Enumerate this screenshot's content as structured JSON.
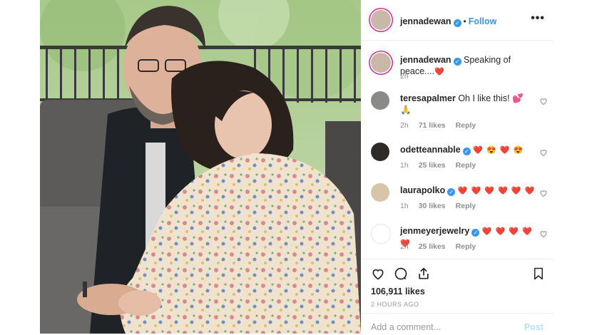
{
  "header": {
    "username": "jennadewan",
    "verified": true,
    "follow_label": "Follow",
    "dot": "•",
    "more": "•••"
  },
  "caption": {
    "username": "jennadewan",
    "text": "Speaking of peace....",
    "emoji": "❤️",
    "time": "2h"
  },
  "comments": [
    {
      "username": "teresapalmer",
      "verified": false,
      "text": "Oh I like this! 💕 🙏",
      "time": "2h",
      "likes": "71 likes",
      "reply": "Reply"
    },
    {
      "username": "odetteannable",
      "verified": true,
      "text": "❤️ 😍 ❤️ 😍",
      "time": "1h",
      "likes": "25 likes",
      "reply": "Reply"
    },
    {
      "username": "laurapolko",
      "verified": true,
      "text": "❤️ ❤️ ❤️ ❤️ ❤️ ❤️",
      "time": "1h",
      "likes": "30 likes",
      "reply": "Reply"
    },
    {
      "username": "jenmeyerjewelry",
      "verified": true,
      "text": "❤️ ❤️ ❤️ ❤️ ❤️",
      "time": "2h",
      "likes": "25 likes",
      "reply": "Reply"
    }
  ],
  "actions": {
    "icons": [
      "heart-icon",
      "comment-icon",
      "share-icon",
      "bookmark-icon"
    ],
    "likes": "106,911 likes",
    "posted": "2 HOURS AGO"
  },
  "add_comment": {
    "placeholder": "Add a comment...",
    "post_label": "Post"
  },
  "colors": {
    "link": "#3897f0",
    "heart": "#ed4956",
    "muted": "#8e8e8e"
  }
}
